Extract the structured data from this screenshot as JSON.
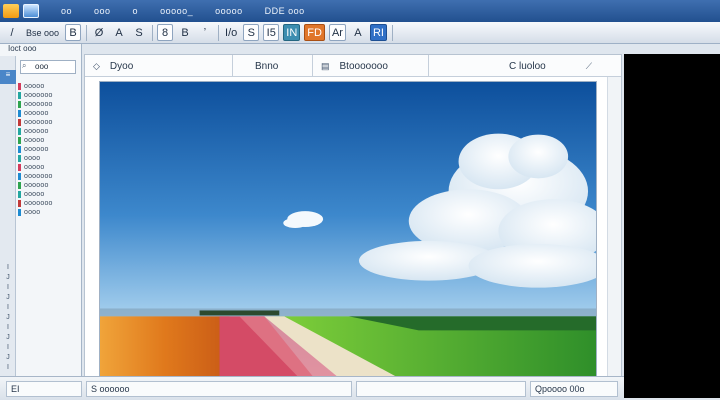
{
  "menu": {
    "items": [
      "oo",
      "ooo",
      "o",
      "ooooo_",
      "ooooo",
      "DDE ooo"
    ]
  },
  "toolbar": {
    "buttons": [
      "/",
      "Bse ooo",
      "B",
      "Ø",
      "A",
      "S",
      "8",
      "B",
      "ʼ",
      "I/o",
      "S",
      "I5",
      "IN",
      "FD",
      "Ar",
      "A",
      "RI"
    ]
  },
  "left_panel": {
    "header": "Ioct ooo",
    "search_value": "ooo",
    "tree_items": [
      "ooooo",
      "ooooooo",
      "ooooooo",
      "oooooo",
      "ooooooo",
      "oooooo",
      "ooooo",
      "oooooo",
      "oooo",
      "ooooo",
      "ooooooo",
      "oooooo",
      "ooooo",
      "ooooooo",
      "oooo"
    ],
    "tree_colors": [
      "#d43b5c",
      "#23a7a1",
      "#2fa44f",
      "#1e8bd1",
      "#c23a3a",
      "#23a7a1",
      "#2fa44f",
      "#1e8bd1",
      "#23a7a1",
      "#d43b5c",
      "#1e8bd1",
      "#2fa44f",
      "#23a7a1",
      "#c23a3a",
      "#1e8bd1"
    ],
    "strip_marks": [
      "I",
      "J",
      "I",
      "J",
      "I",
      "J",
      "I",
      "J",
      "I",
      "J",
      "I"
    ]
  },
  "doc_tabs": [
    {
      "icon": "◇",
      "label": "Dyoo"
    },
    {
      "icon": "",
      "label": "Bnno"
    },
    {
      "icon": "▤",
      "label": "Btooooooo"
    },
    {
      "icon": "",
      "label": "C  luoloo"
    }
  ],
  "status": {
    "cells": [
      "EI",
      "S  oooooo",
      "",
      "Qpoooo 00o"
    ]
  }
}
